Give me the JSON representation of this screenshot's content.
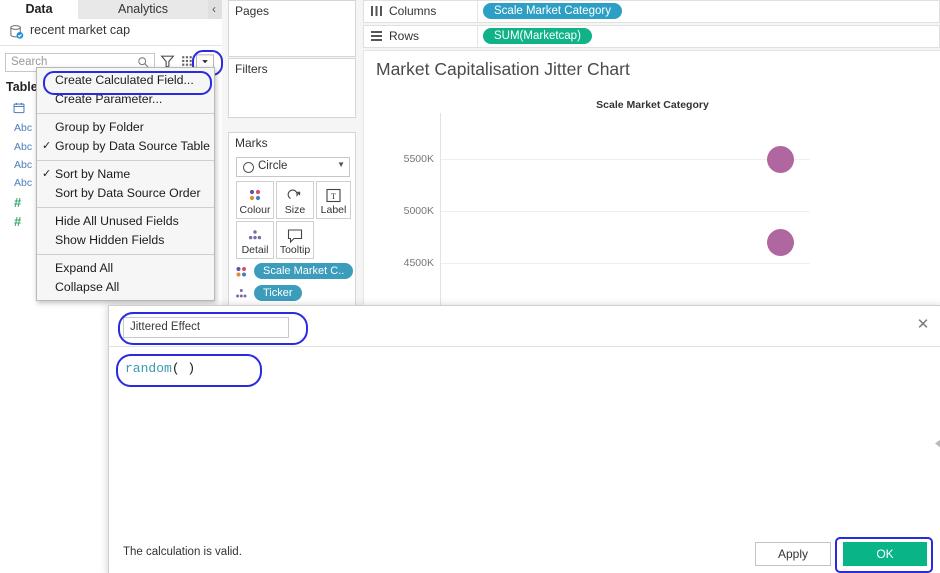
{
  "data_pane": {
    "tabs": [
      {
        "label": "Data",
        "active": true
      },
      {
        "label": "Analytics",
        "active": false
      }
    ],
    "collapse_chevron": "‹",
    "data_source": {
      "name": "recent market cap",
      "icon": "database-icon"
    },
    "search": {
      "placeholder": "Search",
      "icons": [
        "search-icon",
        "filter-icon",
        "grid-icon",
        "chevron-down-icon"
      ]
    },
    "table_label": "Table",
    "fields": [
      {
        "type_icon": "date-icon",
        "glyph": "⛃"
      },
      {
        "type_icon": "string-icon",
        "glyph": "Abc"
      },
      {
        "type_icon": "string-icon",
        "glyph": "Abc"
      },
      {
        "type_icon": "string-icon",
        "glyph": "Abc"
      },
      {
        "type_icon": "string-icon",
        "glyph": "Abc"
      },
      {
        "type_icon": "number-icon",
        "glyph": "#"
      },
      {
        "type_icon": "number-icon",
        "glyph": "#"
      }
    ]
  },
  "context_menu": {
    "groups": [
      [
        {
          "label": "Create Calculated Field...",
          "checked": false,
          "highlighted": true
        },
        {
          "label": "Create Parameter...",
          "checked": false,
          "highlighted": false
        }
      ],
      [
        {
          "label": "Group by Folder",
          "checked": false,
          "highlighted": false
        },
        {
          "label": "Group by Data Source Table",
          "checked": true,
          "highlighted": false
        }
      ],
      [
        {
          "label": "Sort by Name",
          "checked": true,
          "highlighted": false
        },
        {
          "label": "Sort by Data Source Order",
          "checked": false,
          "highlighted": false
        }
      ],
      [
        {
          "label": "Hide All Unused Fields",
          "checked": false,
          "highlighted": false
        },
        {
          "label": "Show Hidden Fields",
          "checked": false,
          "highlighted": false
        }
      ],
      [
        {
          "label": "Expand All",
          "checked": false,
          "highlighted": false
        },
        {
          "label": "Collapse All",
          "checked": false,
          "highlighted": false
        }
      ]
    ],
    "check_glyph": "✓"
  },
  "shelf_panel": {
    "pages_title": "Pages",
    "filters_title": "Filters",
    "marks_title": "Marks",
    "mark_type": "Circle",
    "mark_buttons": [
      {
        "label": "Colour",
        "icon": "colour-icon"
      },
      {
        "label": "Size",
        "icon": "size-icon"
      },
      {
        "label": "Label",
        "icon": "label-icon"
      },
      {
        "label": "Detail",
        "icon": "detail-icon"
      },
      {
        "label": "Tooltip",
        "icon": "tooltip-icon"
      }
    ],
    "mark_pills": [
      {
        "label": "Scale Market C..",
        "icon": "colour-icon",
        "colour": "#3c9cbc"
      },
      {
        "label": "Ticker",
        "icon": "detail-icon",
        "colour": "#3c9cbc"
      }
    ]
  },
  "shelves": {
    "columns_label": "Columns",
    "columns_pill": "Scale Market Category",
    "columns_pill_colour": "#2e9fc4",
    "rows_label": "Rows",
    "rows_pill": "SUM(Marketcap)",
    "rows_pill_colour": "#10b387"
  },
  "chart_data": {
    "type": "scatter",
    "title": "Market Capitalisation Jitter Chart",
    "column_header": "Scale Market Category",
    "xlabel": "Scale Market Category",
    "ylabel": "SUM(Marketcap)",
    "ytick_labels": [
      "5500K",
      "5000K",
      "4500K"
    ],
    "ytick_values": [
      5500000,
      5000000,
      4500000
    ],
    "ylim": [
      4350000,
      5700000
    ],
    "grid": true,
    "legend": "none",
    "mark_colour": "#b0679f",
    "points": [
      {
        "x": "Scale Market Category",
        "y": 5450000,
        "label": ""
      },
      {
        "x": "Scale Market Category",
        "y": 4720000,
        "label": ""
      }
    ]
  },
  "dialog": {
    "name_value": "Jittered Effect",
    "close_glyph": "✕",
    "formula_function": "random",
    "formula_parens": "( )",
    "status_text": "The calculation is valid.",
    "apply_label": "Apply",
    "ok_label": "OK",
    "ok_colour": "#09b587",
    "highlight_colour": "#2a2ae0"
  }
}
